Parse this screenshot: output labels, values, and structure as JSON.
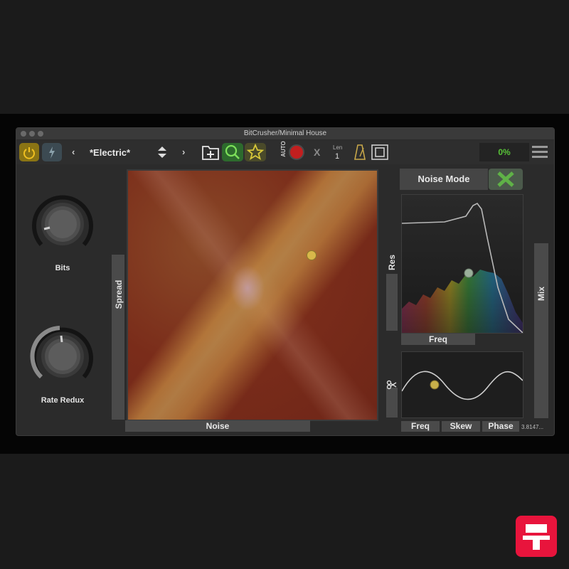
{
  "window": {
    "title": "BitCrusher/Minimal House"
  },
  "toolbar": {
    "preset_name": "*Electric*",
    "prev_label": "‹",
    "next_label": "›",
    "auto_label": "AUTO",
    "x_label": "X",
    "len_label": "Len",
    "len_value": "1",
    "cpu_percent": "0%"
  },
  "left": {
    "bits_label": "Bits",
    "rate_label": "Rate Redux",
    "spread_label": "Spread"
  },
  "xy_pad": {
    "x_label": "Noise"
  },
  "right": {
    "noise_mode_label": "Noise Mode",
    "res_label": "Res",
    "freq_label": "Freq",
    "mix_label": "Mix",
    "lfo_side_icon": "scissors-icon",
    "lfo_freq_label": "Freq",
    "lfo_skew_label": "Skew",
    "lfo_phase_label": "Phase",
    "lfo_value": "3.8147..."
  },
  "colors": {
    "accent_yellow": "#d8b84a",
    "power_button": "#7a6a1c",
    "cpu_green": "#58c338",
    "close_green": "#5fb247"
  }
}
